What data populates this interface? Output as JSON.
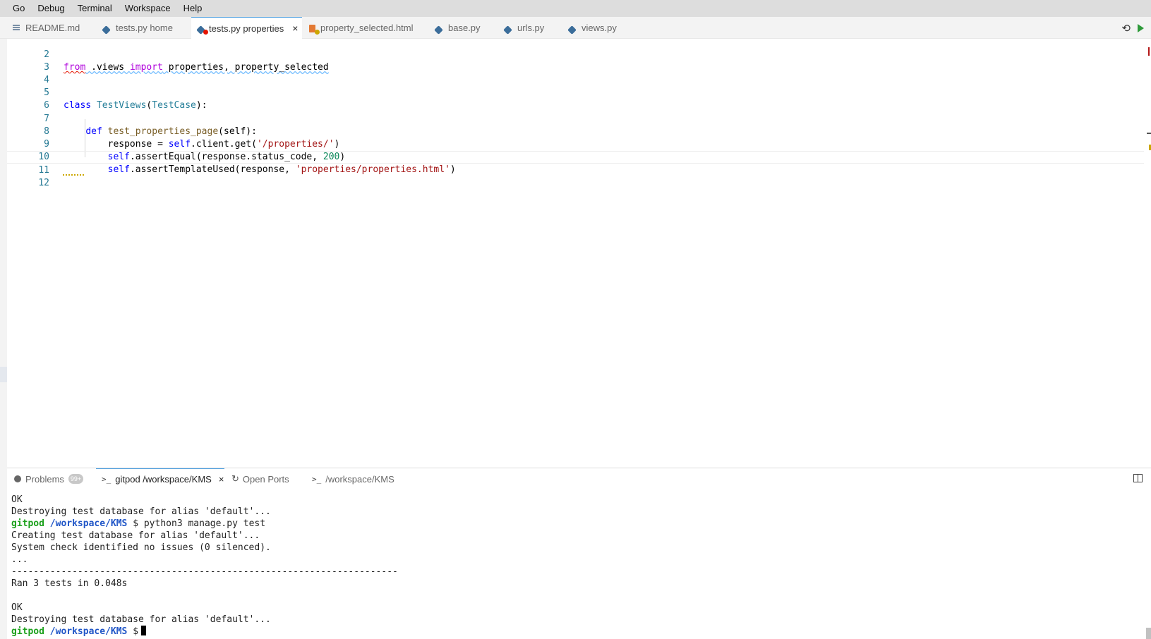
{
  "menubar": {
    "items": [
      "Go",
      "Debug",
      "Terminal",
      "Workspace",
      "Help"
    ]
  },
  "tabs": [
    {
      "label": "README.md",
      "icon": "markdown-icon"
    },
    {
      "label": "tests.py  home",
      "icon": "python-icon"
    },
    {
      "label": "tests.py  properties",
      "icon": "python-icon",
      "active": true,
      "badge": "error"
    },
    {
      "label": "property_selected.html",
      "icon": "html-icon",
      "badge": "warning"
    },
    {
      "label": "base.py",
      "icon": "python-icon"
    },
    {
      "label": "urls.py",
      "icon": "python-icon"
    },
    {
      "label": "views.py",
      "icon": "python-icon"
    }
  ],
  "tab_close": "×",
  "editor": {
    "line_numbers": [
      "2",
      "3",
      "4",
      "5",
      "6",
      "7",
      "8",
      "9",
      "10",
      "11",
      "12"
    ]
  },
  "code": {
    "l2": {
      "from": "from",
      "mod": " .views ",
      "import": "import",
      "names": " properties, property_selected"
    },
    "l5": {
      "class": "class",
      "name": "TestViews",
      "base": "TestCase",
      "p1": " ",
      "p2": "(",
      "p3": "):"
    },
    "l7": {
      "def": "def",
      "fname": "test_properties_page",
      "args": "(self):",
      "indent": "    ",
      "sp": " "
    },
    "l8": {
      "indent": "        ",
      "a": "response = ",
      "self": "self",
      "b": ".client.get(",
      "str": "'/properties/'",
      "c": ")"
    },
    "l9": {
      "indent": "        ",
      "self": "self",
      "b": ".assertEqual(response.status_code, ",
      "num": "200",
      "c": ")"
    },
    "l10": {
      "indent": "        ",
      "self": "self",
      "b": ".assertTemplateUsed(response, ",
      "str": "'properties/properties.html'",
      "c": ")"
    }
  },
  "panel": {
    "tabs": {
      "problems": "Problems",
      "problems_count": "99+",
      "terminal1": "gitpod /workspace/KMS",
      "ports": "Open Ports",
      "terminal2": "/workspace/KMS"
    },
    "term_prefix": ">_",
    "close": "×"
  },
  "terminal": {
    "lines": [
      "OK",
      "Destroying test database for alias 'default'...",
      "",
      "Creating test database for alias 'default'...",
      "System check identified no issues (0 silenced).",
      "...",
      "----------------------------------------------------------------------",
      "Ran 3 tests in 0.048s",
      "",
      "OK",
      "Destroying test database for alias 'default'..."
    ],
    "prompt_user": "gitpod",
    "prompt_path": "/workspace/KMS",
    "prompt_sign": "$",
    "command": "python3 manage.py test"
  },
  "colors": {
    "keyword": "#0000ff",
    "class_name": "#267f99",
    "string": "#a31515",
    "number": "#098658",
    "prompt_user": "#1ba01b",
    "prompt_path": "#1f55c7"
  }
}
